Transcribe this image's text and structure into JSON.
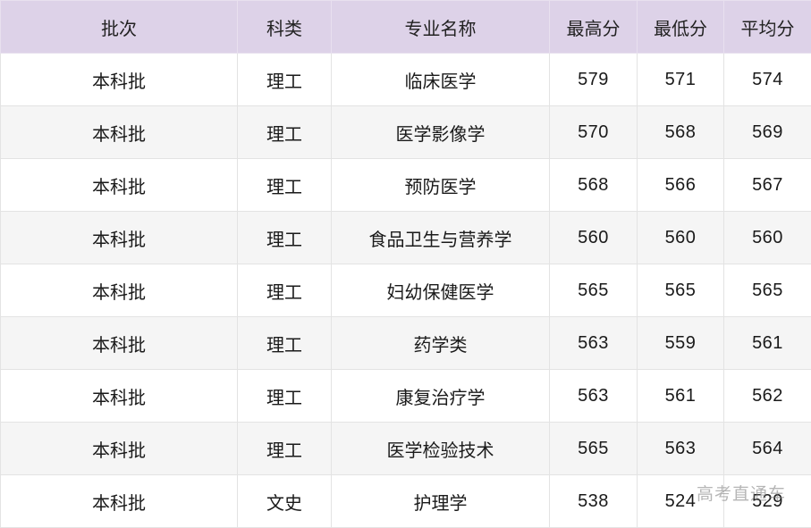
{
  "table": {
    "headers": [
      "批次",
      "科类",
      "专业名称",
      "最高分",
      "最低分",
      "平均分"
    ],
    "rows": [
      [
        "本科批",
        "理工",
        "临床医学",
        "579",
        "571",
        "574"
      ],
      [
        "本科批",
        "理工",
        "医学影像学",
        "570",
        "568",
        "569"
      ],
      [
        "本科批",
        "理工",
        "预防医学",
        "568",
        "566",
        "567"
      ],
      [
        "本科批",
        "理工",
        "食品卫生与营养学",
        "560",
        "560",
        "560"
      ],
      [
        "本科批",
        "理工",
        "妇幼保健医学",
        "565",
        "565",
        "565"
      ],
      [
        "本科批",
        "理工",
        "药学类",
        "563",
        "559",
        "561"
      ],
      [
        "本科批",
        "理工",
        "康复治疗学",
        "563",
        "561",
        "562"
      ],
      [
        "本科批",
        "理工",
        "医学检验技术",
        "565",
        "563",
        "564"
      ],
      [
        "本科批",
        "文史",
        "护理学",
        "538",
        "524",
        "529"
      ]
    ]
  },
  "watermark": "高考直通车",
  "colors": {
    "header_bg": "#ddd2e8",
    "row_alt_bg": "#f5f5f5",
    "row_bg": "#ffffff"
  }
}
